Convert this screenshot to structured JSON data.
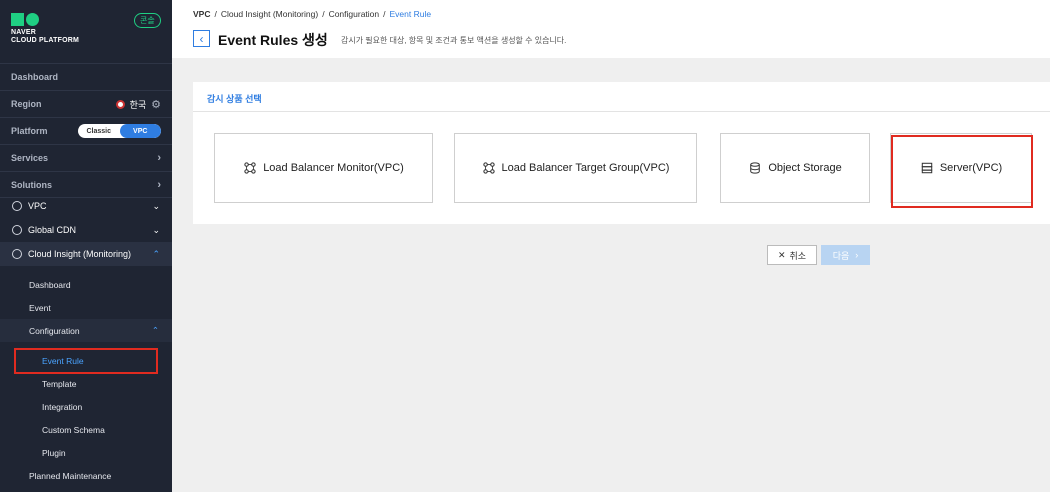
{
  "sidebar": {
    "logo_line1": "NAVER",
    "logo_line2": "CLOUD PLATFORM",
    "lang_badge": "콘솔",
    "dashboard": "Dashboard",
    "region_label": "Region",
    "region_value": "한국",
    "platform_label": "Platform",
    "platform_classic": "Classic",
    "platform_vpc": "VPC",
    "services": "Services",
    "solutions": "Solutions",
    "svc_vpc": "VPC",
    "svc_cdn": "Global CDN",
    "svc_ci": "Cloud Insight (Monitoring)",
    "sub_dashboard": "Dashboard",
    "sub_event": "Event",
    "sub_configuration": "Configuration",
    "subsub_event_rule": "Event Rule",
    "subsub_template": "Template",
    "subsub_integration": "Integration",
    "subsub_custom_schema": "Custom Schema",
    "subsub_plugin": "Plugin",
    "sub_planned_maintenance": "Planned Maintenance"
  },
  "breadcrumb": {
    "b1": "VPC",
    "b2": "Cloud Insight (Monitoring)",
    "b3": "Configuration",
    "b4": "Event Rule",
    "sep": "/"
  },
  "page": {
    "title": "Event Rules 생성",
    "description": "감시가 필요한 대상, 항목 및 조건과 통보 액션을 생성할 수 있습니다."
  },
  "card": {
    "title": "감시 상품 선택",
    "products": [
      {
        "label": "Load Balancer Monitor(VPC)",
        "icon": "network-icon"
      },
      {
        "label": "Load Balancer Target Group(VPC)",
        "icon": "network-icon"
      },
      {
        "label": "Object Storage",
        "icon": "database-icon"
      },
      {
        "label": "Server(VPC)",
        "icon": "server-icon"
      }
    ]
  },
  "buttons": {
    "cancel": "취소",
    "next": "다음"
  },
  "colors": {
    "accent": "#2f7de1",
    "sidebar_bg": "#1f2533",
    "brand_green": "#1fcf83",
    "highlight_red": "#e02b20"
  }
}
